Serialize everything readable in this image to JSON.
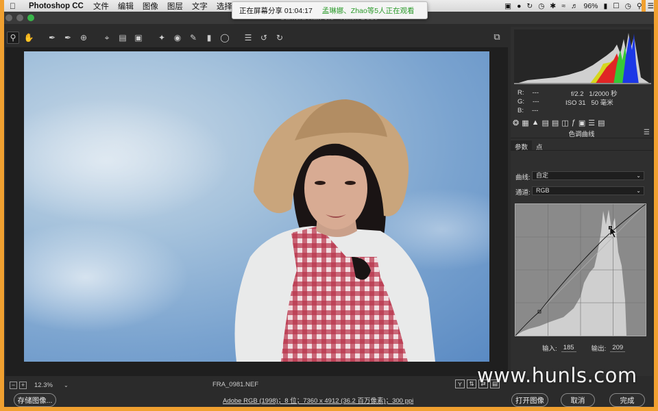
{
  "menubar": {
    "app": "Photoshop CC",
    "items": [
      "文件",
      "编辑",
      "图像",
      "图层",
      "文字",
      "选择"
    ],
    "battery": "96%"
  },
  "share": {
    "status": "正在屏幕分享 01:04:17",
    "viewers": "孟琳娜、Zhao等5人正在观看"
  },
  "window": {
    "title": "Camera Raw 9.0  -  Nikon D810"
  },
  "toolbar": {
    "tools": [
      "zoom-icon",
      "hand-icon",
      "white-balance-icon",
      "color-sampler-icon",
      "target-adjust-icon",
      "crop-icon",
      "straighten-icon",
      "transform-icon",
      "spot-removal-icon",
      "red-eye-icon",
      "adjustment-brush-icon",
      "graduated-filter-icon",
      "radial-filter-icon",
      "preferences-icon",
      "rotate-left-icon",
      "rotate-right-icon"
    ]
  },
  "status": {
    "zoom": "12.3%",
    "filename": "FRA_0981.NEF",
    "view_y": "Y"
  },
  "bottom": {
    "save": "存储图像...",
    "workflow": "Adobe RGB (1998)；8 位；7360 x 4912 (36.2 百万像素)；300 ppi",
    "open": "打开图像",
    "cancel": "取消",
    "done": "完成"
  },
  "readout": {
    "r_label": "R:",
    "g_label": "G:",
    "b_label": "B:",
    "r": "---",
    "g": "---",
    "b": "---",
    "aperture": "f/2.2",
    "shutter": "1/2000 秒",
    "iso": "ISO 31",
    "focal": "50 毫米"
  },
  "panel": {
    "title": "色调曲线",
    "tabs": [
      "参数",
      "点"
    ],
    "curve_label": "曲线:",
    "curve_value": "自定",
    "channel_label": "通道:",
    "channel_value": "RGB",
    "input_label": "输入:",
    "input_value": "185",
    "output_label": "输出:",
    "output_value": "209"
  },
  "watermark": "www.hunls.com"
}
